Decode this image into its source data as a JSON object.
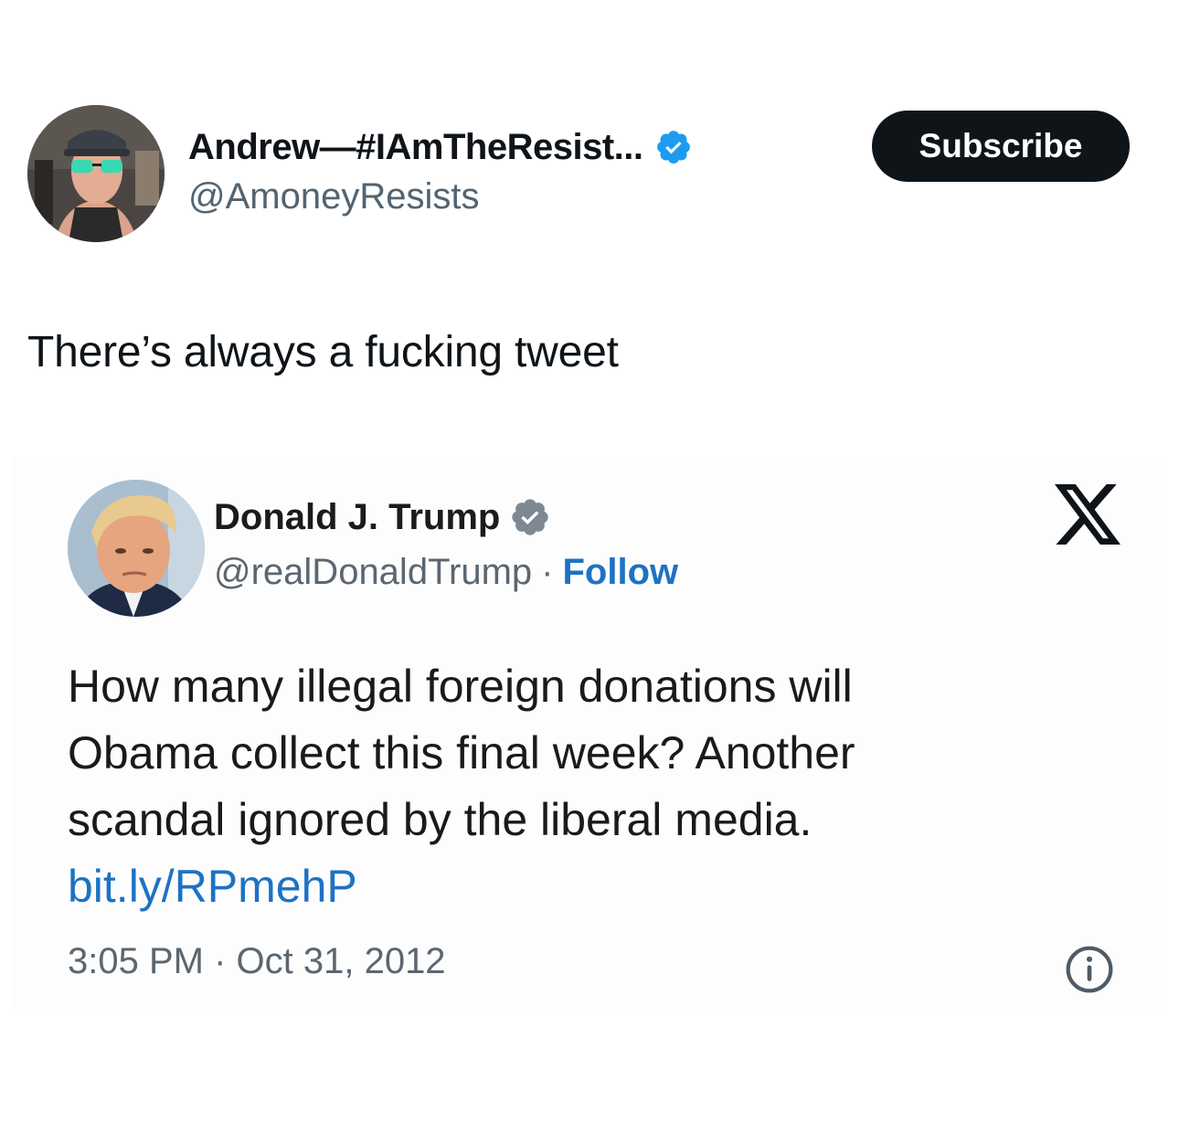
{
  "post": {
    "author_name": "Andrew—#IAmTheResist...",
    "author_handle": "@AmoneyResists",
    "subscribe_label": "Subscribe",
    "text": "There’s always a fucking tweet",
    "verified_color": "#1d9bf0"
  },
  "embedded_tweet": {
    "author_name": "Donald J. Trump",
    "author_handle": "@realDonaldTrump",
    "separator": "·",
    "follow_label": "Follow",
    "text_lines": [
      "How many illegal foreign donations will",
      "Obama collect this final week? Another",
      "scandal ignored by the liberal media."
    ],
    "link": "bit.ly/RPmehP",
    "timestamp": "3:05 PM · Oct 31, 2012",
    "link_color": "#1d72c4",
    "icons": {
      "brand": "x-logo-icon",
      "info": "info-icon",
      "verified": "verified-badge-icon"
    }
  }
}
